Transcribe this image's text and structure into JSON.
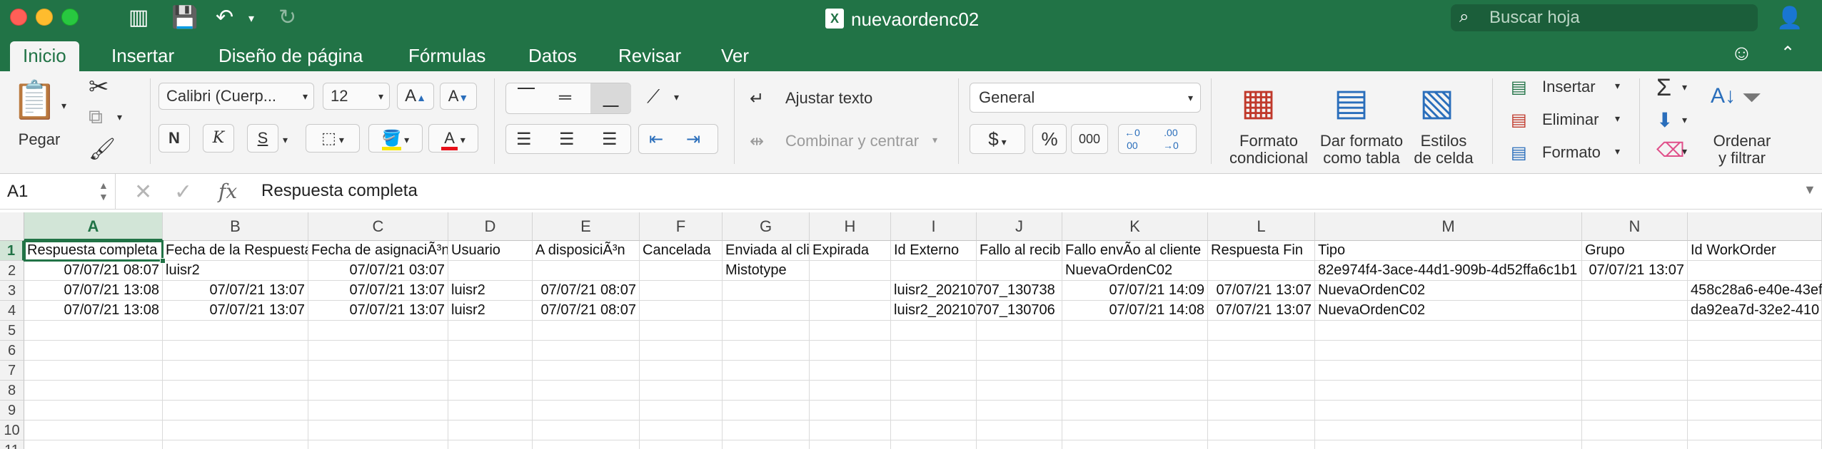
{
  "window": {
    "title": "nuevaordenc02",
    "search_placeholder": "Buscar hoja"
  },
  "tabs": [
    "Inicio",
    "Insertar",
    "Diseño de página",
    "Fórmulas",
    "Datos",
    "Revisar",
    "Ver"
  ],
  "ribbon": {
    "paste_label": "Pegar",
    "font_name": "Calibri (Cuerp...",
    "font_size": "12",
    "bold": "N",
    "italic": "K",
    "underline": "S",
    "wrap_text": "Ajustar texto",
    "merge_center": "Combinar y centrar",
    "number_format": "General",
    "percent": "%",
    "thousands": "000",
    "currency": "$",
    "conditional_format": [
      "Formato",
      "condicional"
    ],
    "format_as_table": [
      "Dar formato",
      "como tabla"
    ],
    "cell_styles": [
      "Estilos",
      "de celda"
    ],
    "insert": "Insertar",
    "delete": "Eliminar",
    "format": "Formato",
    "sort_filter": [
      "Ordenar",
      "y filtrar"
    ]
  },
  "formula_bar": {
    "name_box": "A1",
    "content": "Respuesta completa"
  },
  "sheet": {
    "columns": [
      "A",
      "B",
      "C",
      "D",
      "E",
      "F",
      "G",
      "H",
      "I",
      "J",
      "K",
      "L",
      "M",
      "N"
    ],
    "row_numbers": [
      "1",
      "2",
      "3",
      "4",
      "5",
      "6",
      "7",
      "8",
      "9",
      "10",
      "11"
    ],
    "rows": [
      [
        "Respuesta completa",
        "Fecha de la Respuesta",
        "Fecha de asignaciÃ³n",
        "Usuario",
        "A disposiciÃ³n",
        "Cancelada",
        "Enviada al cli",
        "Expirada",
        "Id Externo",
        "Fallo al recib",
        "Fallo envÃ­o al cliente",
        "Respuesta Fin",
        "Tipo",
        "Grupo",
        "Id WorkOrder"
      ],
      [
        "07/07/21 08:07",
        "luisr2",
        "07/07/21 03:07",
        "",
        "",
        "",
        "Mistotype",
        "",
        "",
        "",
        "NuevaOrdenC02",
        "",
        "82e974f4-3ace-44d1-909b-4d52ffa6c1b1",
        "07/07/21 13:07",
        ""
      ],
      [
        "07/07/21 13:08",
        "07/07/21 13:07",
        "07/07/21 13:07",
        "luisr2",
        "07/07/21 08:07",
        "",
        "",
        "",
        "luisr2_20210707_130738",
        "",
        "07/07/21 14:09",
        "07/07/21 13:07",
        "NuevaOrdenC02",
        "",
        "458c28a6-e40e-43ef"
      ],
      [
        "07/07/21 13:08",
        "07/07/21 13:07",
        "07/07/21 13:07",
        "luisr2",
        "07/07/21 08:07",
        "",
        "",
        "",
        "luisr2_20210707_130706",
        "",
        "07/07/21 14:08",
        "07/07/21 13:07",
        "NuevaOrdenC02",
        "",
        "da92ea7d-32e2-410"
      ]
    ]
  }
}
